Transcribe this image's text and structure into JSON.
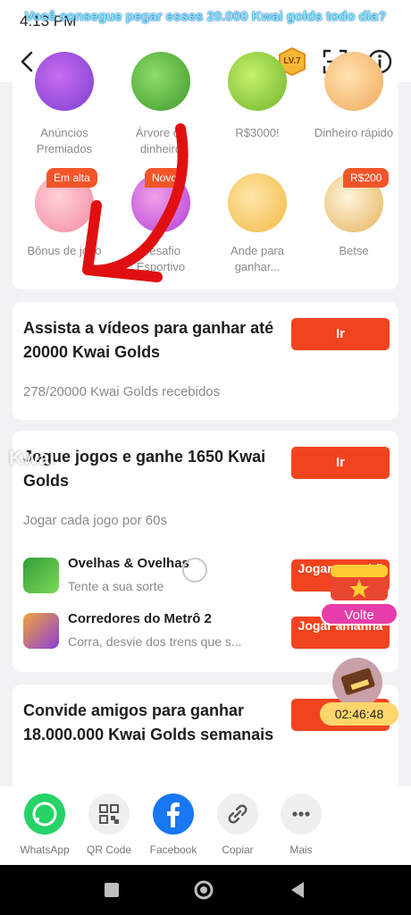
{
  "status_bar": {
    "time": "4:13 PM",
    "caption": "Você consegue pegar esses 20.000 Kwai golds todo dia?"
  },
  "header": {
    "level": "LV.7",
    "icons": [
      "back-icon",
      "scan-icon",
      "info-icon"
    ]
  },
  "features": [
    {
      "label": "Anúncios Premiados",
      "tag": ""
    },
    {
      "label": "Árvore de dinheiro",
      "tag": ""
    },
    {
      "label": "R$3000!",
      "tag": ""
    },
    {
      "label": "Dinheiro rápido",
      "tag": ""
    },
    {
      "label": "Bônus de jogo",
      "tag": "Em alta"
    },
    {
      "label": "Desafio Esportivo",
      "tag": "Novo"
    },
    {
      "label": "Ande para ganhar...",
      "tag": ""
    },
    {
      "label": "Betse",
      "tag": "R$200"
    }
  ],
  "tasks": {
    "videos": {
      "title": "Assista a vídeos para ganhar até 20000 Kwai Golds",
      "progress_text": "278/20000 Kwai Golds recebidos",
      "button": "Ir"
    },
    "games": {
      "title": "Jogue jogos e ganhe 1650 Kwai Golds",
      "subtitle": "Jogar cada jogo por 60s",
      "button": "Ir",
      "items": [
        {
          "name": "Ovelhas & Ovelhas",
          "desc": "Tente a sua sorte",
          "button": "Jogar amanhã"
        },
        {
          "name": "Corredores do Metrô 2",
          "desc": "Corra, desvie dos trens que s...",
          "button": "Jogar amanhã"
        }
      ]
    },
    "invite": {
      "title": "Convide amigos para ganhar 18.000.000 Kwai Golds semanais"
    }
  },
  "floating": {
    "return_label": "Volte",
    "timer": "02:46:48"
  },
  "watermark": "Kwai",
  "share": [
    {
      "label": "WhatsApp",
      "icon": "whatsapp-icon",
      "color": "#25d366"
    },
    {
      "label": "QR Code",
      "icon": "qr-code-icon",
      "color": "#efefef"
    },
    {
      "label": "Facebook",
      "icon": "facebook-icon",
      "color": "#1877f2"
    },
    {
      "label": "Copiar",
      "icon": "link-icon",
      "color": "#efefef"
    },
    {
      "label": "Mais",
      "icon": "more-icon",
      "color": "#efefef"
    }
  ],
  "colors": {
    "accent": "#f2431f",
    "tag": "#f2552a",
    "volte": "#e83ca8",
    "timer": "#ffd66b"
  }
}
